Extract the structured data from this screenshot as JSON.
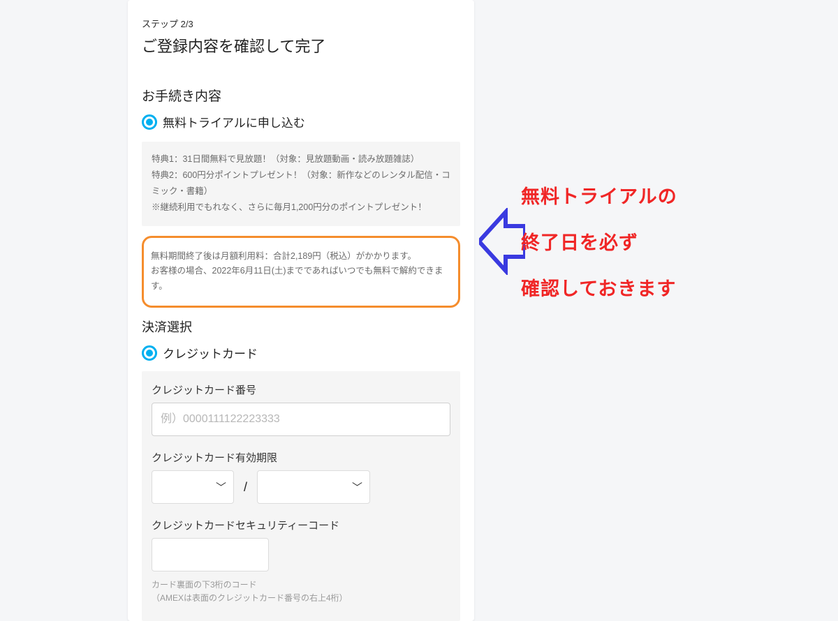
{
  "step": "ステップ 2/3",
  "title": "ご登録内容を確認して完了",
  "procHeading": "お手続き内容",
  "trialLabel": "無料トライアルに申し込む",
  "benefits": {
    "line1": "特典1：31日間無料で見放題！（対象：見放題動画・読み放題雑誌）",
    "line2a": "特典2：600円分ポイントプレゼント！（対象：新作などのレンタル配信・コ",
    "line2b": "ミック・書籍）",
    "line3": "※継続利用でもれなく、さらに毎月1,200円分のポイントプレゼント！"
  },
  "notice": {
    "line1": "無料期間終了後は月額利用料：合計2,189円（税込）がかかります。",
    "line2": "お客様の場合、2022年6月11日(土)までであればいつでも無料で解約できます。"
  },
  "paySelectHeading": "決済選択",
  "creditLabel": "クレジットカード",
  "form": {
    "cardLabel": "クレジットカード番号",
    "cardPlaceholder": "例）0000111122223333",
    "expLabel": "クレジットカード有効期限",
    "slash": "/",
    "secLabel": "クレジットカードセキュリティーコード",
    "hint1": "カード裏面の下3桁のコード",
    "hint2": "（AMEXは表面のクレジットカード番号の右上4桁）"
  },
  "annotation": {
    "l1": "無料トライアルの",
    "l2": "終了日を必ず",
    "l3": "確認しておきます"
  }
}
